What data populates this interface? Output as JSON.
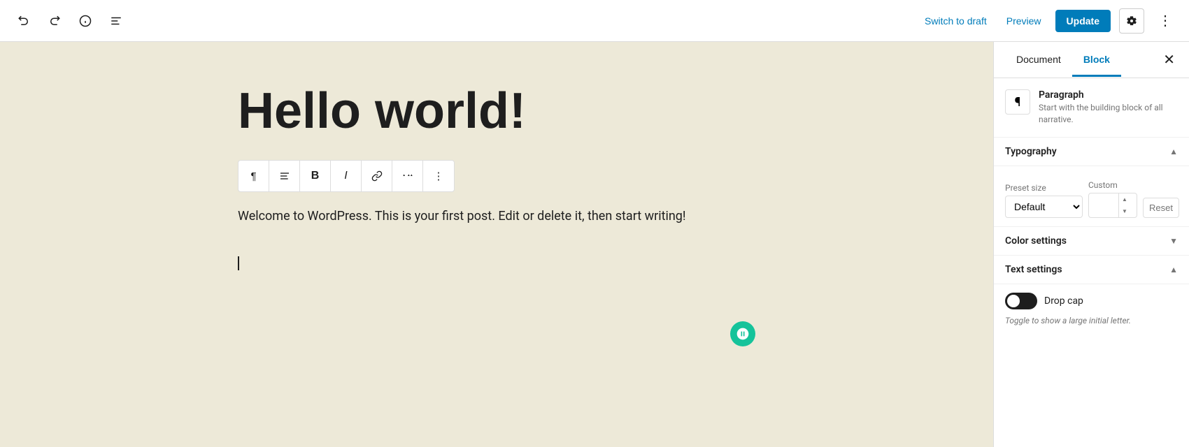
{
  "topbar": {
    "switch_draft_label": "Switch to draft",
    "preview_label": "Preview",
    "update_label": "Update"
  },
  "editor": {
    "post_title": "Hello world!",
    "post_body": "Welcome to WordPress. This is your first post. Edit or delete it, then start writing!",
    "toolbar": {
      "paragraph_btn": "¶",
      "align_btn": "≡",
      "bold_btn": "B",
      "italic_btn": "I",
      "link_btn": "🔗",
      "more_options_btn": "⋮"
    }
  },
  "sidebar": {
    "document_tab": "Document",
    "block_tab": "Block",
    "block_info": {
      "name": "Paragraph",
      "description": "Start with the building block of all narrative."
    },
    "typography": {
      "label": "Typography",
      "preset_label": "Preset size",
      "custom_label": "Custom",
      "preset_value": "Default",
      "reset_label": "Reset"
    },
    "color_settings": {
      "label": "Color settings"
    },
    "text_settings": {
      "label": "Text settings",
      "drop_cap_label": "Drop cap",
      "drop_cap_hint": "Toggle to show a large initial letter."
    }
  }
}
